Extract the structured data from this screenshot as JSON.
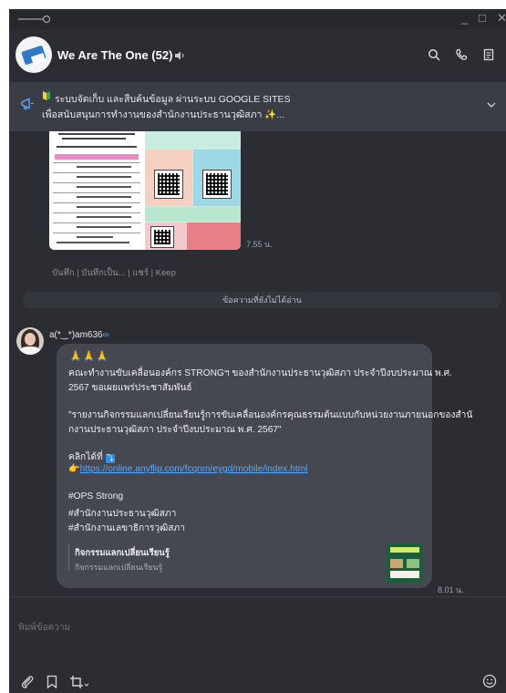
{
  "window": {
    "minimize": "_",
    "maximize": "□",
    "close": "✕"
  },
  "header": {
    "title": "We Are The One (52)"
  },
  "announcement": {
    "line1": "ระบบจัดเก็บ และสืบค้นข้อมูล ผ่านระบบ GOOGLE SITES",
    "line2": "เพื่อสนับสนุนการทำงานของสำนักงานประธานวุฒิสภา ✨..."
  },
  "image_message": {
    "time": "7.55 น.",
    "actions": "บันทึก | บันทึกเป็น... | แชร์ | Keep"
  },
  "unread_divider": "ข้อความที่ยังไม่ได้อ่าน",
  "message": {
    "sender": "a(*‿*)am636",
    "sender_suffix": "∞",
    "emoji": "🙏🙏🙏",
    "line1": "คณะทำงานขับเคลื่อนองค์กร STRONGฯ ของสำนักงานประธานวุฒิสภา ประจำปีงบประมาณ พ.ศ.",
    "line2": "2567 ขอเผยแพร่ประชาสัมพันธ์",
    "line3": "\"รายงานกิจกรรมแลกเปลี่ยนเรียนรู้การขับเคลื่อนองค์กรคุณธรรมต้นแบบกับหน่วยงานภายนอกของสำนั",
    "line4": "กงานประธานวุฒิสภา ประจำปีงบประมาณ พ.ศ. 2567\"",
    "line5": "คลิกได้ที่",
    "link_prefix": "👉",
    "link": "https://online.anyflip.com/fcqnm/eygd/mobile/index.html",
    "tag1": "#OPS Strong",
    "tag2": "#สำนักงานประธานวุฒิสภา",
    "tag3": "#สำนักงานเลขาธิการวุฒิสภา",
    "card_title": "กิจกรรมแลกเปลี่ยนเรียนรู้",
    "card_subtitle": "กิจกรรมแลกเปลี่ยนเรียนรู้",
    "time": "8.01 น."
  },
  "compose": {
    "placeholder": "พิมพ์ข้อความ"
  }
}
